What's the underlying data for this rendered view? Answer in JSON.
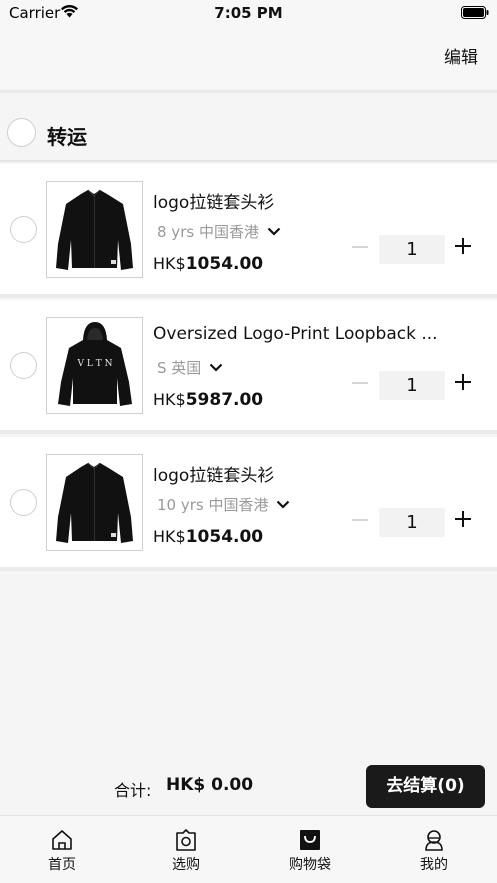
{
  "status_bar": {
    "carrier": "Carrier",
    "time": "7:05 PM"
  },
  "nav": {
    "edit_label": "编辑"
  },
  "group": {
    "title": "转运"
  },
  "items": [
    {
      "name": "logo拉链套头衫",
      "spec": "8 yrs 中国香港",
      "currency": "HK$",
      "price": "1054.00",
      "quantity": "1",
      "image": "black-zip-jacket"
    },
    {
      "name": "Oversized Logo-Print Loopback ...",
      "spec": "S 英国",
      "currency": "HK$",
      "price": "5987.00",
      "quantity": "1",
      "image": "black-vltn-hoodie"
    },
    {
      "name": "logo拉链套头衫",
      "spec": "10 yrs 中国香港",
      "currency": "HK$",
      "price": "1054.00",
      "quantity": "1",
      "image": "black-zip-jacket"
    }
  ],
  "summary": {
    "total_label": "合计:",
    "total_value": "HK$ 0.00",
    "checkout_label": "去结算(0)"
  },
  "tabs": [
    {
      "label": "首页",
      "icon": "home-icon"
    },
    {
      "label": "选购",
      "icon": "shop-icon"
    },
    {
      "label": "购物袋",
      "icon": "bag-icon"
    },
    {
      "label": "我的",
      "icon": "profile-icon"
    }
  ],
  "colors": {
    "accent": "#1a1a1a",
    "muted": "#9a9a9a",
    "background": "#f5f5f5"
  }
}
